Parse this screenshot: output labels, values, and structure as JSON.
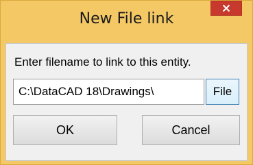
{
  "window": {
    "title": "New File link",
    "close_icon": "close-icon"
  },
  "dialog": {
    "prompt": "Enter filename to link to this entity.",
    "path_value": "C:\\DataCAD 18\\Drawings\\",
    "file_button_label": "File",
    "ok_label": "OK",
    "cancel_label": "Cancel"
  },
  "colors": {
    "frame": "#f3c865",
    "close_button": "#c7392c",
    "client_background": "#f0f0f0",
    "file_button_border": "#3c7fb1"
  }
}
